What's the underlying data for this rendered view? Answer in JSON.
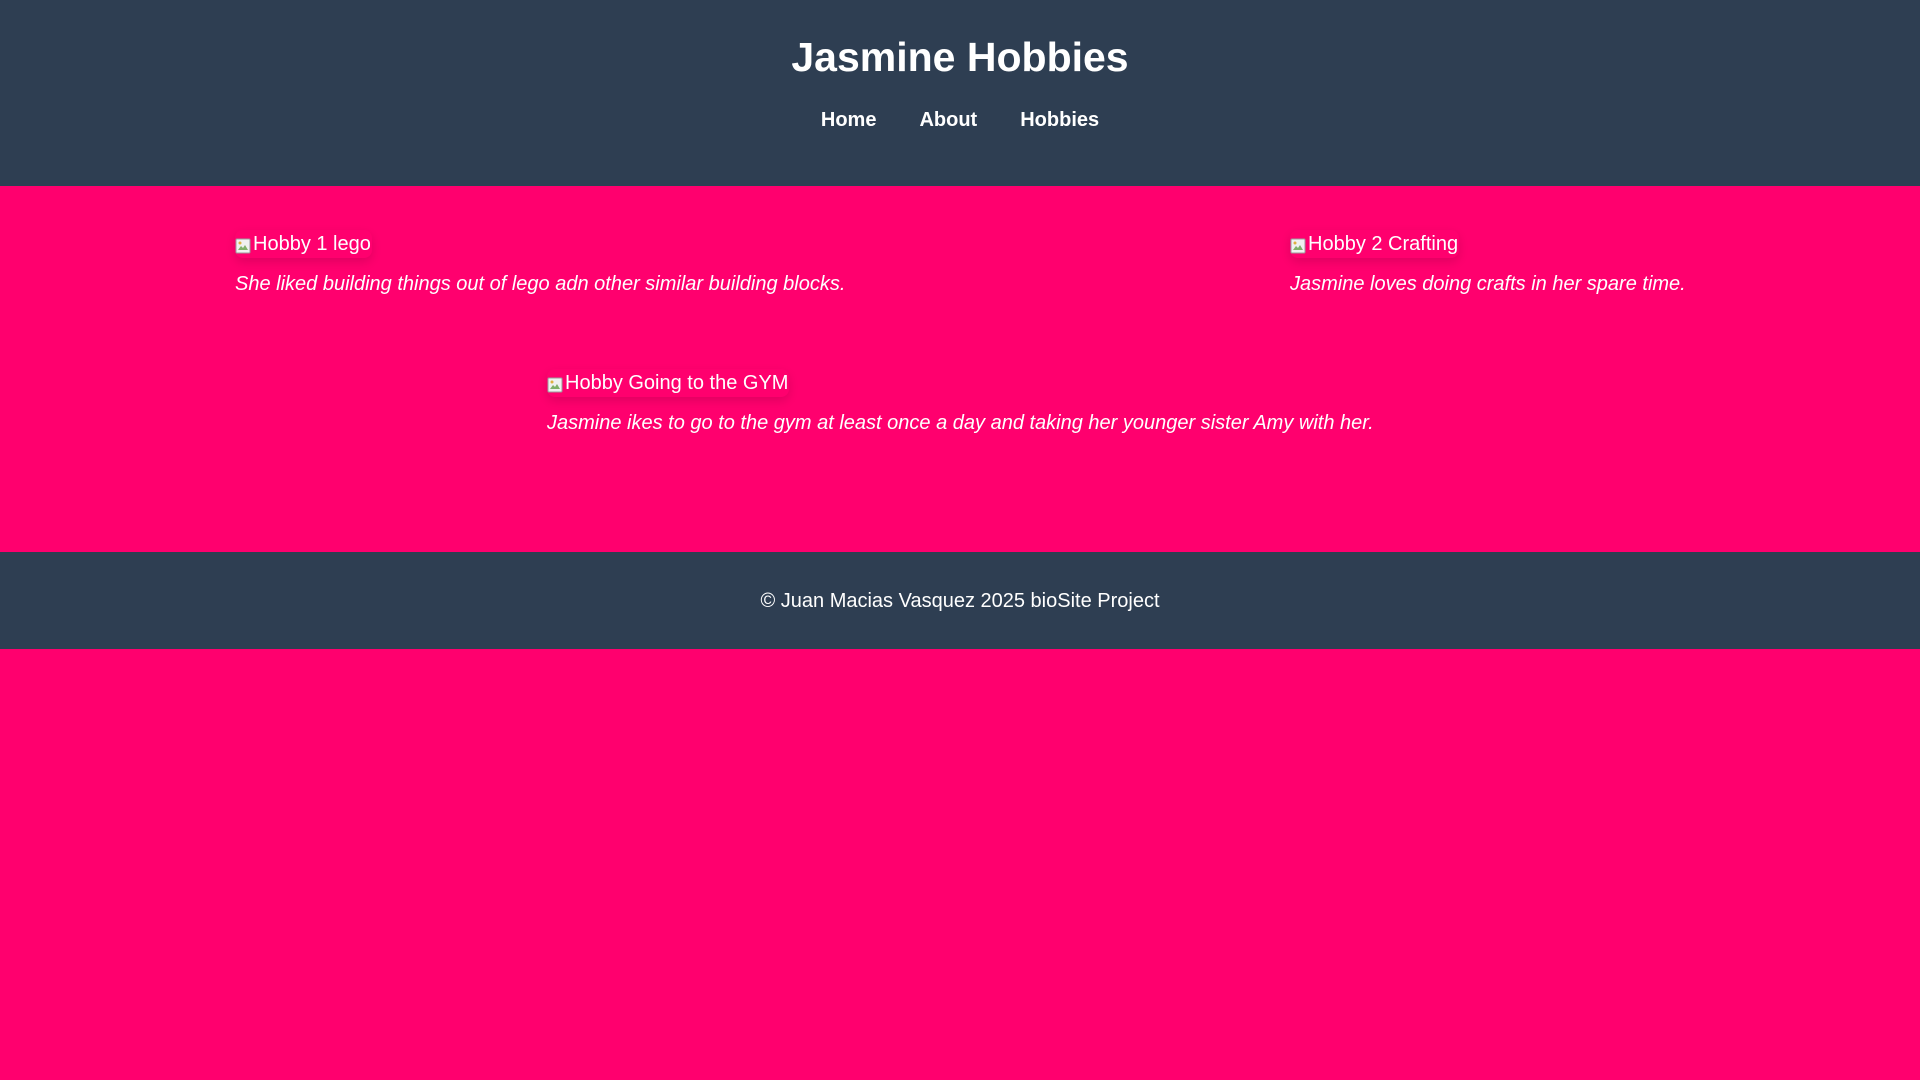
{
  "header": {
    "title": "Jasmine Hobbies",
    "nav": [
      {
        "label": "Home"
      },
      {
        "label": "About"
      },
      {
        "label": "Hobbies"
      }
    ]
  },
  "hobbies": [
    {
      "image_alt": "Hobby 1 lego",
      "caption": "She liked building things out of lego adn other similar building blocks."
    },
    {
      "image_alt": "Hobby 2 Crafting",
      "caption": "Jasmine loves doing crafts in her spare time."
    },
    {
      "image_alt": "Hobby Going to the GYM",
      "caption": "Jasmine ikes to go to the gym at least once a day and taking her younger sister Amy with her."
    }
  ],
  "footer": {
    "text": "© Juan Macias Vasquez 2025 bioSite Project"
  },
  "colors": {
    "page_background": "#ff006e",
    "header_footer_background": "#2e3e52",
    "text": "#ffffff"
  },
  "icons": {
    "broken_image": "broken-image-icon"
  }
}
